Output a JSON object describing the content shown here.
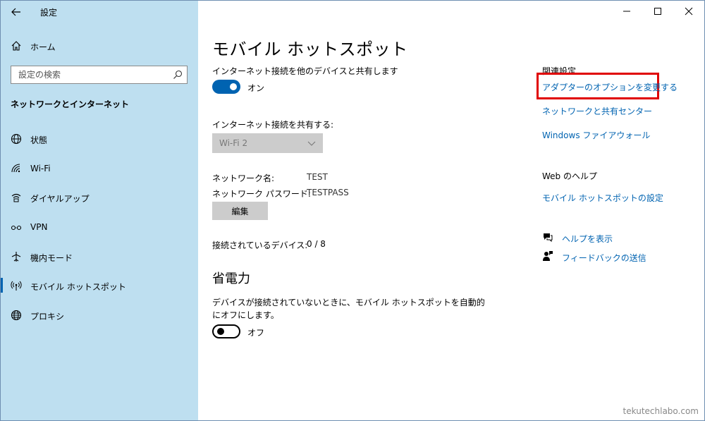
{
  "window": {
    "title": "設定"
  },
  "sidebar": {
    "home_label": "ホーム",
    "search_placeholder": "設定の検索",
    "section_title": "ネットワークとインターネット",
    "items": [
      {
        "label": "状態",
        "icon": "globe-status-icon"
      },
      {
        "label": "Wi-Fi",
        "icon": "wifi-icon"
      },
      {
        "label": "ダイヤルアップ",
        "icon": "dialup-icon"
      },
      {
        "label": "VPN",
        "icon": "vpn-icon"
      },
      {
        "label": "機内モード",
        "icon": "airplane-icon"
      },
      {
        "label": "モバイル ホットスポット",
        "icon": "hotspot-icon",
        "active": true
      },
      {
        "label": "プロキシ",
        "icon": "proxy-globe-icon"
      }
    ]
  },
  "main": {
    "title": "モバイル ホットスポット",
    "share_label": "インターネット接続を他のデバイスと共有します",
    "share_state": "オン",
    "share_from_label": "インターネット接続を共有する:",
    "share_from_value": "Wi-Fi 2",
    "network_name_label": "ネットワーク名:",
    "network_name_value": "TEST",
    "network_password_label": "ネットワーク パスワード:",
    "network_password_value": "TESTPASS",
    "edit_button": "編集",
    "connected_label": "接続されているデバイス:",
    "connected_value": "0 / 8",
    "power_title": "省電力",
    "power_desc": "デバイスが接続されていないときに、モバイル ホットスポットを自動的にオフにします。",
    "power_state": "オフ"
  },
  "related": {
    "heading": "関連設定",
    "links": [
      "アダプターのオプションを変更する",
      "ネットワークと共有センター",
      "Windows ファイアウォール"
    ],
    "web_help_heading": "Web のヘルプ",
    "web_help_link": "モバイル ホットスポットの設定",
    "help_link": "ヘルプを表示",
    "feedback_link": "フィードバックの送信"
  },
  "watermark": "tekutechlabo.com",
  "colors": {
    "sidebar_bg": "#bedff0",
    "accent": "#0063b1",
    "highlight": "#e00000"
  }
}
